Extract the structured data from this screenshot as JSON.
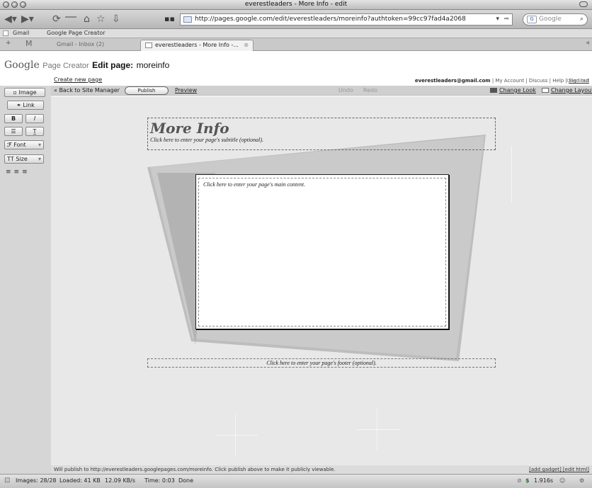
{
  "window": {
    "title": "everestleaders - More Info - edit"
  },
  "browser": {
    "url": "http://pages.google.com/edit/everestleaders/moreinfo?authtoken=99cc97fad4a2068",
    "search_placeholder": "Google",
    "bookmarks": [
      "Gmail",
      "Google Page Creator"
    ],
    "tabs": [
      {
        "label": "Gmail - Inbox (2)"
      },
      {
        "label": "everestleaders - More Info -..."
      }
    ]
  },
  "header": {
    "logo": "Google",
    "product": "Page Creator",
    "edit_label": "Edit page:",
    "page_name": "moreinfo",
    "create_new": "Create new page",
    "user_email": "everestleaders@gmail.com",
    "links_text": " | My Account | Discuss | Help | ",
    "sign_out": "Sign out",
    "unsaved": "Unedited"
  },
  "toolbar": {
    "back": "« Back to Site Manager",
    "publish": "Publish",
    "preview": "Preview",
    "undo": "Undo",
    "redo": "Redo",
    "change_look": "Change Look",
    "change_layout": "Change Layout"
  },
  "sidebar": {
    "image": "Image",
    "link": "Link",
    "bold": "B",
    "italic": "I",
    "font": "Font",
    "size": "Size"
  },
  "page": {
    "title": "More Info",
    "subtitle": "Click here to enter your page's subtitle (optional).",
    "main_content": "Click here to enter your page's main content.",
    "footer": "Click here to enter your page's footer (optional)."
  },
  "bottom": {
    "note": "Will publish to http://everestleaders.googlepages.com/moreinfo. Click publish above to make it publicly viewable.",
    "links": "[add gadget] [edit html]"
  },
  "status": {
    "images": "Images: 28/28",
    "loaded": "Loaded: 41 KB",
    "speed": "12.09 KB/s",
    "time": "Time: 0:03",
    "done": "Done",
    "timer": "1.916s"
  }
}
